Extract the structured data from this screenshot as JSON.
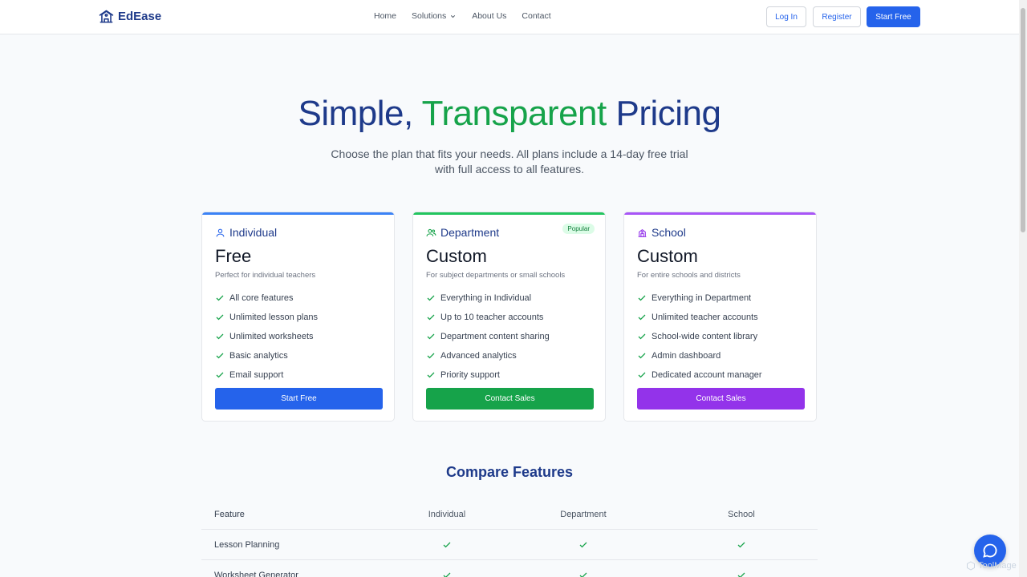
{
  "brand": {
    "name": "EdEase",
    "logo_icon": "school-building-icon"
  },
  "nav": {
    "links": [
      "Home",
      "Solutions",
      "About Us",
      "Contact"
    ],
    "login": "Log In",
    "register": "Register",
    "start_free": "Start Free"
  },
  "hero": {
    "title_part1": "Simple, ",
    "title_accent": "Transparent",
    "title_part2": " Pricing",
    "subtitle": "Choose the plan that fits your needs. All plans include a 14-day free trial with full access to all features."
  },
  "plans": [
    {
      "name": "Individual",
      "icon": "user-icon",
      "price": "Free",
      "desc": "Perfect for individual teachers",
      "features": [
        "All core features",
        "Unlimited lesson plans",
        "Unlimited worksheets",
        "Basic analytics",
        "Email support"
      ],
      "cta": "Start Free",
      "accent": "#3b82f6"
    },
    {
      "name": "Department",
      "icon": "users-icon",
      "badge": "Popular",
      "price": "Custom",
      "desc": "For subject departments or small schools",
      "features": [
        "Everything in Individual",
        "Up to 10 teacher accounts",
        "Department content sharing",
        "Advanced analytics",
        "Priority support"
      ],
      "cta": "Contact Sales",
      "accent": "#22c55e"
    },
    {
      "name": "School",
      "icon": "school-icon",
      "price": "Custom",
      "desc": "For entire schools and districts",
      "features": [
        "Everything in Department",
        "Unlimited teacher accounts",
        "School-wide content library",
        "Admin dashboard",
        "Dedicated account manager"
      ],
      "cta": "Contact Sales",
      "accent": "#a855f7"
    }
  ],
  "compare": {
    "title": "Compare Features",
    "headers": [
      "Feature",
      "Individual",
      "Department",
      "School"
    ],
    "rows": [
      {
        "feature": "Lesson Planning"
      },
      {
        "feature": "Worksheet Generator"
      }
    ]
  },
  "watermark": "ToolMage",
  "colors": {
    "primary": "#2563eb",
    "navy": "#1e3a8a",
    "green": "#16a34a",
    "purple": "#9333ea"
  }
}
